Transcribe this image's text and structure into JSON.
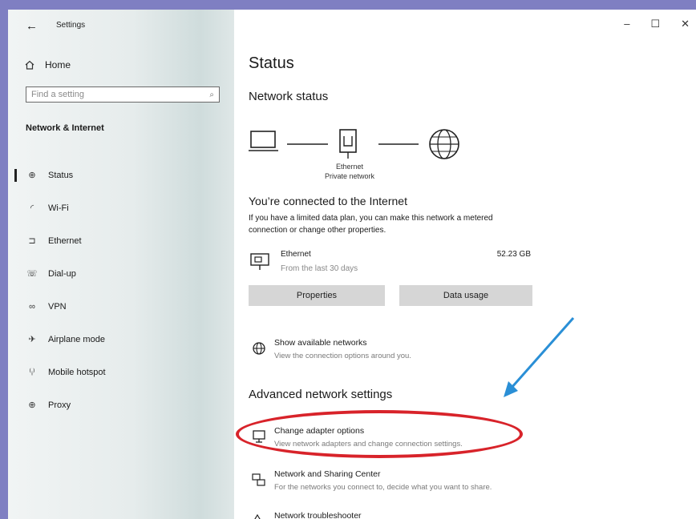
{
  "window": {
    "title": "Settings",
    "controls": {
      "minimize": "–",
      "maximize": "☐",
      "close": "✕"
    }
  },
  "sidebar": {
    "back_icon": "arrow-left-icon",
    "home_label": "Home",
    "search": {
      "placeholder": "Find a setting"
    },
    "section_title": "Network & Internet",
    "items": [
      {
        "label": "Status",
        "icon": "globe-icon",
        "active": true
      },
      {
        "label": "Wi-Fi",
        "icon": "wifi-icon"
      },
      {
        "label": "Ethernet",
        "icon": "ethernet-icon"
      },
      {
        "label": "Dial-up",
        "icon": "phone-icon"
      },
      {
        "label": "VPN",
        "icon": "vpn-icon"
      },
      {
        "label": "Airplane mode",
        "icon": "airplane-icon"
      },
      {
        "label": "Mobile hotspot",
        "icon": "hotspot-icon"
      },
      {
        "label": "Proxy",
        "icon": "globe-icon"
      }
    ]
  },
  "main": {
    "page_title": "Status",
    "network_status_title": "Network status",
    "diagram": {
      "caption_line1": "Ethernet",
      "caption_line2": "Private network"
    },
    "connected_title": "You’re connected to the Internet",
    "connected_text": "If you have a limited data plan, you can make this network a metered connection or change other properties.",
    "ethernet": {
      "name": "Ethernet",
      "subtitle": "From the last 30 days",
      "usage": "52.23 GB"
    },
    "buttons": {
      "properties": "Properties",
      "data_usage": "Data usage"
    },
    "show_networks": {
      "title": "Show available networks",
      "subtitle": "View the connection options around you."
    },
    "advanced_title": "Advanced network settings",
    "adapter": {
      "title": "Change adapter options",
      "subtitle": "View network adapters and change connection settings."
    },
    "sharing": {
      "title": "Network and Sharing Center",
      "subtitle": "For the networks you connect to, decide what you want to share."
    },
    "troubleshooter": {
      "title": "Network troubleshooter"
    }
  },
  "colors": {
    "annotation_ellipse": "#d8232a",
    "annotation_arrow": "#2a8fd6",
    "frame": "#7f7fc2"
  }
}
